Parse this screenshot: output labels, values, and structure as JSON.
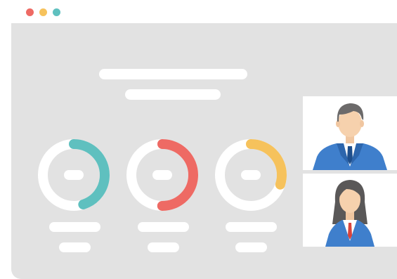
{
  "window": {
    "controls": [
      {
        "name": "close",
        "color": "#ee6a64"
      },
      {
        "name": "minimize",
        "color": "#f6c25c"
      },
      {
        "name": "maximize",
        "color": "#5fc0bf"
      }
    ],
    "background": "#e2e2e2"
  },
  "dashboard": {
    "gauges": [
      {
        "name": "gauge-teal",
        "color": "#5fc0bf",
        "value": 0.45
      },
      {
        "name": "gauge-red",
        "color": "#ee6a64",
        "value": 0.5
      },
      {
        "name": "gauge-yellow",
        "color": "#f6c25c",
        "value": 0.3
      }
    ]
  },
  "video_call": {
    "participants": [
      {
        "name": "participant-man",
        "icon": "male-avatar-icon",
        "shirt_color": "#3f7fcc"
      },
      {
        "name": "participant-woman",
        "icon": "female-avatar-icon",
        "shirt_color": "#3f7fcc"
      }
    ]
  }
}
